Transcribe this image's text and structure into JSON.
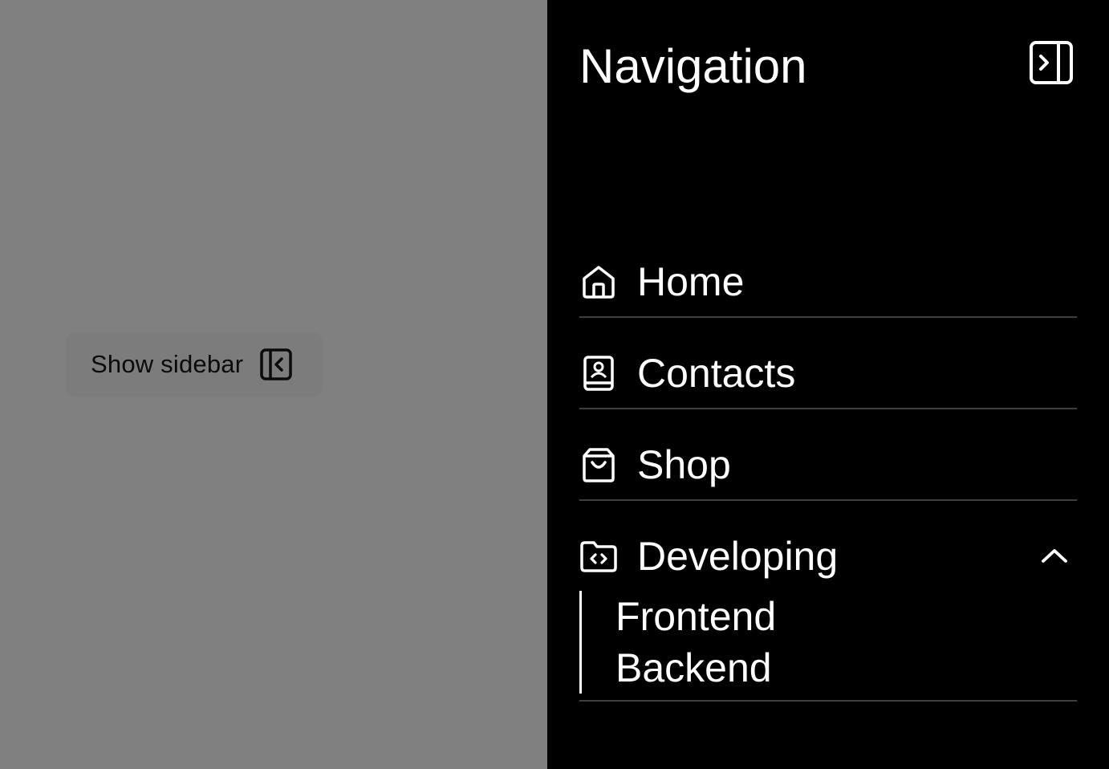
{
  "overlay": {
    "show_sidebar_label": "Show sidebar"
  },
  "sidebar": {
    "title": "Navigation",
    "items": [
      {
        "label": "Home",
        "icon": "home-icon"
      },
      {
        "label": "Contacts",
        "icon": "contact-book-icon"
      },
      {
        "label": "Shop",
        "icon": "shopping-bag-icon"
      }
    ],
    "group": {
      "label": "Developing",
      "icon": "folder-code-icon",
      "expanded": true,
      "children": [
        "Frontend",
        "Backend"
      ]
    }
  },
  "colors": {
    "overlay_bg": "#808080",
    "sidebar_bg": "#000000",
    "text": "#ffffff",
    "divider": "#3f3f3f"
  }
}
